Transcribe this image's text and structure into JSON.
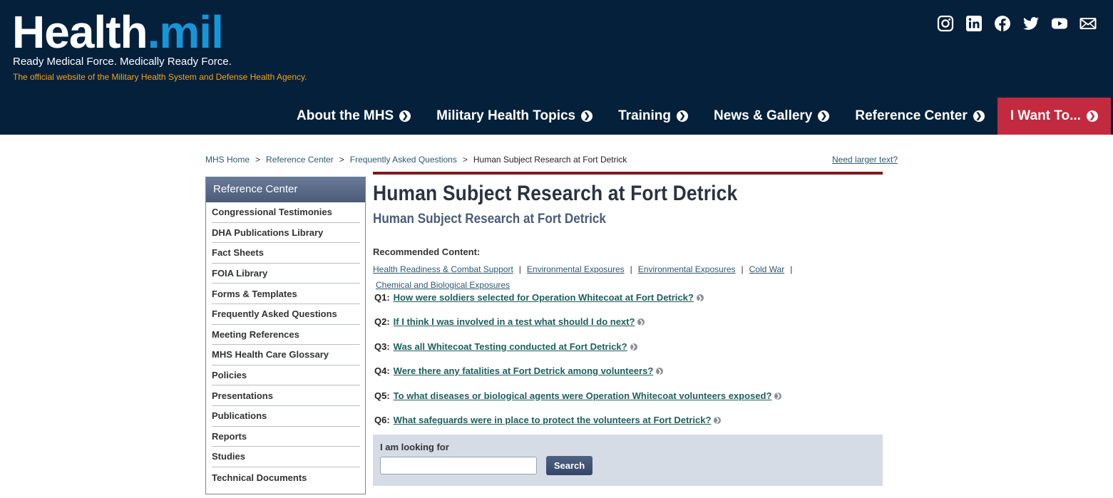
{
  "header": {
    "logo_main": "Health",
    "logo_dot_mil": ".mil",
    "tagline": "Ready Medical Force. Medically Ready Force.",
    "subtagline": "The official website of the Military Health System and Defense Health Agency.",
    "social_icons": [
      "instagram-icon",
      "linkedin-icon",
      "facebook-icon",
      "twitter-icon",
      "youtube-icon",
      "email-icon"
    ]
  },
  "nav": {
    "items": [
      {
        "label": "About the MHS"
      },
      {
        "label": "Military Health Topics"
      },
      {
        "label": "Training"
      },
      {
        "label": "News & Gallery"
      },
      {
        "label": "Reference Center"
      },
      {
        "label": "I Want To..."
      }
    ],
    "search_icon": "search-icon"
  },
  "breadcrumb": {
    "items": [
      "MHS Home",
      "Reference Center",
      "Frequently Asked Questions"
    ],
    "current": "Human Subject Research at Fort Detrick",
    "separator": ">"
  },
  "larger_text": "Need larger text?",
  "sidebar": {
    "title": "Reference Center",
    "items": [
      "Congressional Testimonies",
      "DHA Publications Library",
      "Fact Sheets",
      "FOIA Library",
      "Forms & Templates",
      "Frequently Asked Questions",
      "Meeting References",
      "MHS Health Care Glossary",
      "Policies",
      "Presentations",
      "Publications",
      "Reports",
      "Studies",
      "Technical Documents"
    ]
  },
  "main": {
    "title": "Human Subject Research at Fort Detrick",
    "subtitle": "Human Subject Research at Fort Detrick",
    "recommended_label": "Recommended Content:",
    "recommended_links": [
      "Health Readiness & Combat Support",
      "Environmental Exposures",
      "Environmental Exposures",
      "Cold War",
      "Chemical and Biological Exposures"
    ],
    "faqs": [
      {
        "num": "Q1:",
        "text": "How were soldiers selected for Operation Whitecoat at Fort Detrick?"
      },
      {
        "num": "Q2:",
        "text": "If I think I was involved in a test what should I do next?"
      },
      {
        "num": "Q3:",
        "text": "Was all Whitecoat Testing conducted at Fort Detrick?"
      },
      {
        "num": "Q4:",
        "text": "Were there any fatalities at Fort Detrick among volunteers?"
      },
      {
        "num": "Q5:",
        "text": "To what diseases or biological agents were Operation Whitecoat volunteers exposed?"
      },
      {
        "num": "Q6:",
        "text": "What safeguards were in place to protect the volunteers at Fort Detrick?"
      }
    ]
  },
  "search_box": {
    "label": "I am looking for",
    "value": "",
    "button": "Search"
  },
  "colors": {
    "header_bg": "#04203b",
    "logo_accent": "#1596d6",
    "subtagline": "#f4a31f",
    "want_bg": "#c32a3f",
    "rule": "#7d1a1c"
  }
}
